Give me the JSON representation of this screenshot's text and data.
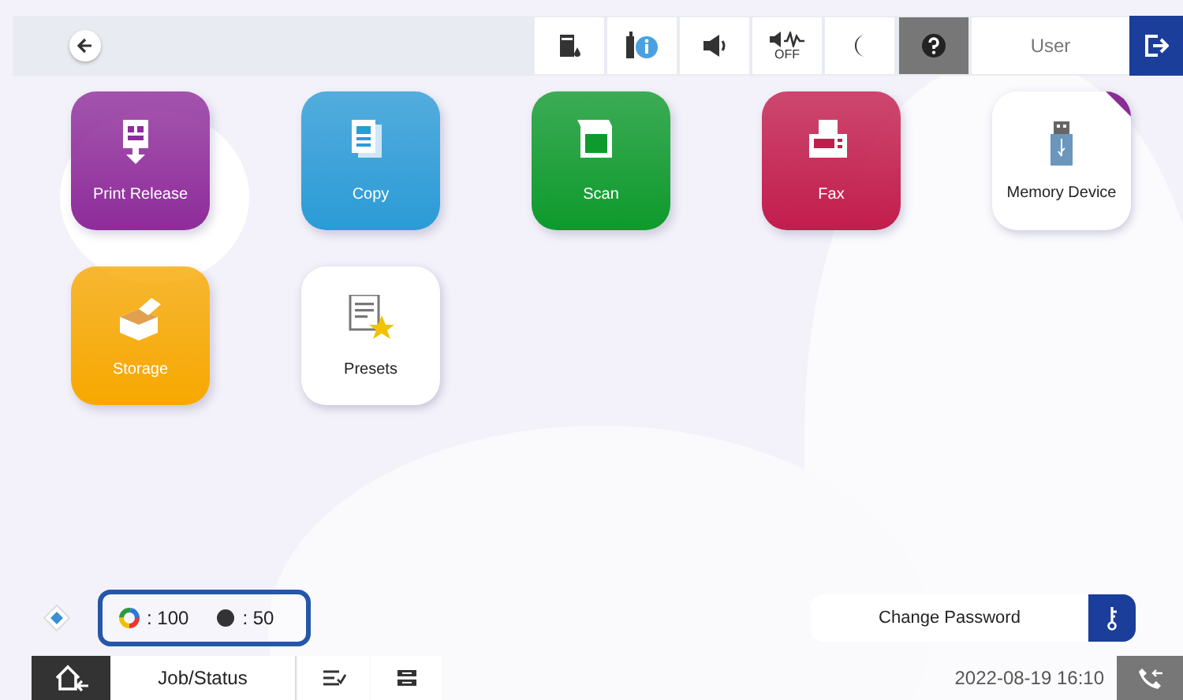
{
  "top_bar": {
    "user": "User",
    "icons": [
      {
        "kind": "ink"
      },
      {
        "kind": "info"
      },
      {
        "kind": "volume"
      },
      {
        "kind": "quiet",
        "text": "OFF"
      },
      {
        "kind": "sleep"
      },
      {
        "kind": "help"
      }
    ]
  },
  "apps": [
    {
      "label": "Print Release",
      "kind": "release",
      "color": "#8e2c9a"
    },
    {
      "label": "Copy",
      "kind": "copy",
      "color": "#2b9bd6"
    },
    {
      "label": "Scan",
      "kind": "scan",
      "color": "#0e9a2c"
    },
    {
      "label": "Fax",
      "kind": "fax",
      "color": "#c21d4c"
    },
    {
      "label": "Memory Device",
      "kind": "memory",
      "color": "#ffffff"
    },
    {
      "label": "Storage",
      "kind": "storage",
      "color": "#f7a800"
    },
    {
      "label": "Presets",
      "kind": "presets",
      "color": "#ffffff"
    }
  ],
  "ink_levels": [
    {
      "kind": "color",
      "reading": ": 100"
    },
    {
      "kind": "black",
      "reading": ": 50"
    }
  ],
  "change_password": "Change Password",
  "bottom_bar": {
    "job_status": "Job/Status",
    "date_time": "2022-08-19 16:10"
  }
}
